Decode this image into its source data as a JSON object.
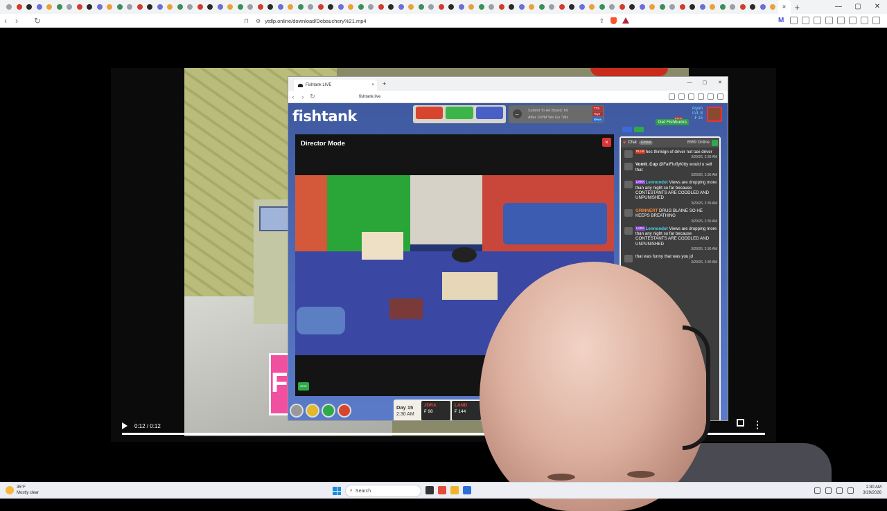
{
  "browser": {
    "tab_count": 77,
    "active_tab_close": "×",
    "new_tab": "+",
    "window_controls": [
      "—",
      "▢",
      "✕"
    ],
    "nav": {
      "back": "‹",
      "forward": "›",
      "reload": "↻"
    },
    "url": "ytdlp.online/download/Debauchery%21.mp4",
    "brand_color": "#4a52d6"
  },
  "video_player": {
    "time": "0:12 / 0:12",
    "progress": 1.0,
    "more": "⋮"
  },
  "cartoon": {
    "letter": "F"
  },
  "inner_browser": {
    "tab_title": "Fishtank LIVE",
    "tab_close": "×",
    "new_tab": "+",
    "window_controls": [
      "—",
      "▢",
      "✕"
    ],
    "nav": {
      "back": "‹",
      "forward": "›",
      "reload": "↻"
    },
    "url": "fishtank.live"
  },
  "fishtank": {
    "logo": "fishtank",
    "adboard_line1": "Submit To Ad Board: hit",
    "adboard_line2": "After 10PM We Go \"Mis",
    "adboard_arrow": "←",
    "tags": [
      "TTS",
      "Toys",
      "News"
    ],
    "profile_name": "Aryeh",
    "profile_level": "LVL 8",
    "profile_coins": "₣ 15",
    "fishbucks_button": "Get Fishbucks",
    "sale_badge": "SALE",
    "director": {
      "title": "Director Mode",
      "close": "×",
      "badge": "NEW"
    },
    "chat": {
      "title": "Chat",
      "channel": "Global",
      "online": "8569 Online",
      "messages": [
        {
          "badge": "PLUS",
          "badge_color": "#d23a1d",
          "name": "",
          "name_color": "#8d4bd6",
          "text": "hes thinkign of driver not taxi driver",
          "time": "3/29/26, 2:30 AM"
        },
        {
          "badge": "",
          "badge_color": "",
          "name": "Vomit_Cup",
          "name_color": "#ffffff",
          "text": "@FatFluffyKitty would u sell that",
          "time": "3/29/26, 2:30 AM"
        },
        {
          "badge": "LARA",
          "badge_color": "#8d4bd6",
          "name": "Lennondot",
          "name_color": "#4ad6f0",
          "text": "Views are dropping more than any night so far because CONTESTANTS ARE CODDLED AND UNPUNISHED",
          "time": "3/29/26, 2:30 AM"
        },
        {
          "badge": "",
          "badge_color": "",
          "name": "GRINNERT",
          "name_color": "#ef8a3a",
          "text": "DRUG BLAINE SO HE KEEPS BREATHING",
          "time": "3/29/26, 2:30 AM"
        },
        {
          "badge": "LARA",
          "badge_color": "#8d4bd6",
          "name": "Lennondot",
          "name_color": "#4ad6f0",
          "text": "Views are dropping more than any night so far because CONTESTANTS ARE CODDLED AND UNPUNISHED",
          "time": "3/29/26, 2:30 AM"
        },
        {
          "badge": "",
          "badge_color": "",
          "name": "",
          "name_color": "#ffffff",
          "text": "that was funny that was you jd",
          "time": "3/29/26, 2:30 AM"
        }
      ]
    },
    "day": {
      "day_label": "Day 15",
      "time": "2:30 AM",
      "stats": [
        {
          "name": "JDRA",
          "value": "₣ 98"
        },
        {
          "name": "LAND",
          "value": "₣ 144"
        }
      ]
    }
  },
  "taskbar": {
    "temperature": "35°F",
    "weather": "Mostly clear",
    "search_placeholder": "Search",
    "time": "2:30 AM",
    "date": "3/29/2026"
  }
}
